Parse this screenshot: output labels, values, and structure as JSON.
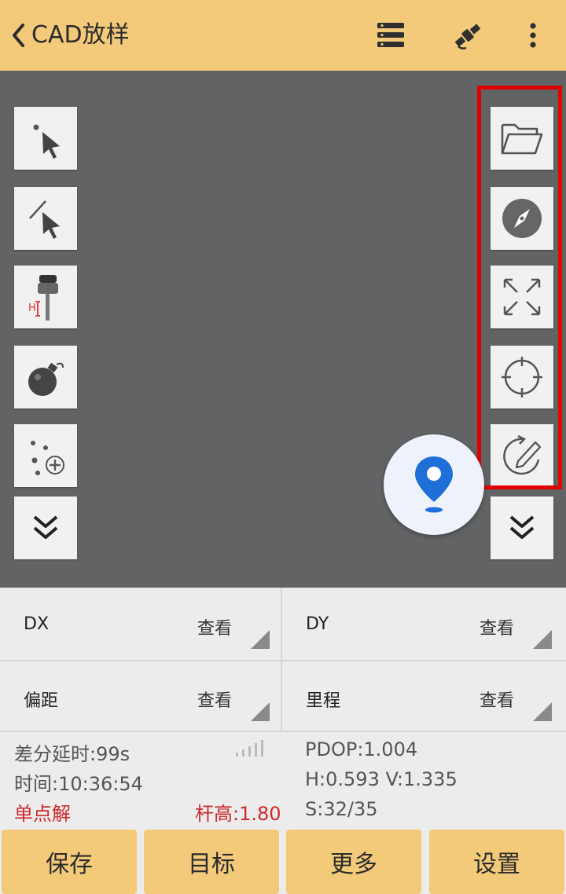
{
  "header": {
    "title": "CAD放样",
    "icons": [
      "back-chevron-icon",
      "layers-menu-icon",
      "satellite-icon",
      "more-vertical-icon"
    ]
  },
  "left_tools": [
    "point-select-icon",
    "line-select-icon",
    "rtk-antenna-height-icon",
    "bomb-clear-icon",
    "add-points-icon",
    "expand-down-icon"
  ],
  "right_tools": [
    "open-folder-icon",
    "compass-icon",
    "zoom-extents-icon",
    "crosshair-target-icon",
    "rotate-edit-icon",
    "expand-down-icon"
  ],
  "colors": {
    "topbar": "#f3c97a",
    "canvas": "#626365",
    "highlight": "#e10000",
    "pin": "#1f6fd8",
    "status_red": "#d0282d"
  },
  "fields": {
    "dx": {
      "label": "DX",
      "action": "查看"
    },
    "dy": {
      "label": "DY",
      "action": "查看"
    },
    "offset": {
      "label": "偏距",
      "action": "查看"
    },
    "mileage": {
      "label": "里程",
      "action": "查看"
    }
  },
  "status": {
    "diff_delay": "差分延时:99s",
    "pdop": "PDOP:1.004",
    "time": "时间:10:36:54",
    "hv": "H:0.593  V:1.335",
    "solution": "单点解",
    "pole_height": "杆高:1.80",
    "sats": "S:32/35"
  },
  "buttons": {
    "save": "保存",
    "target": "目标",
    "more": "更多",
    "settings": "设置"
  }
}
